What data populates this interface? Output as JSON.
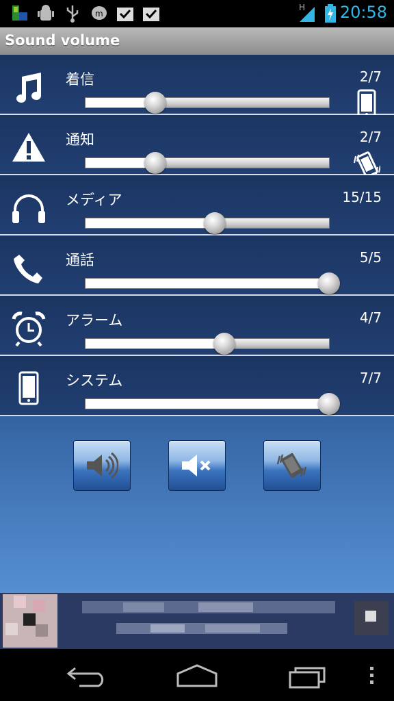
{
  "status_bar": {
    "time": "20:58",
    "network_type": "H",
    "icons": [
      "app-icon",
      "android-debug-icon",
      "usb-icon",
      "messaging-icon",
      "task-done-icon",
      "task-done-icon",
      "signal-icon",
      "battery-charging-icon"
    ]
  },
  "app": {
    "title": "Sound volume"
  },
  "volume_rows": [
    {
      "id": "ringtone",
      "label": "着信",
      "value": "2/7",
      "level": 2,
      "max": 7,
      "icon": "music-note-icon",
      "mode_icon": "phone-icon"
    },
    {
      "id": "notification",
      "label": "通知",
      "value": "2/7",
      "level": 2,
      "max": 7,
      "icon": "warning-icon",
      "mode_icon": "vibrate-icon"
    },
    {
      "id": "media",
      "label": "メディア",
      "value": "15/15",
      "level": 0.53,
      "icon": "headphones-icon"
    },
    {
      "id": "call",
      "label": "通話",
      "value": "5/5",
      "level": 5,
      "max": 5,
      "icon": "phone-handset-icon"
    },
    {
      "id": "alarm",
      "label": "アラーム",
      "value": "4/7",
      "level": 4,
      "max": 7,
      "icon": "alarm-clock-icon"
    },
    {
      "id": "system",
      "label": "システム",
      "value": "7/7",
      "level": 7,
      "max": 7,
      "icon": "smartphone-icon"
    }
  ],
  "mode_buttons": [
    {
      "id": "sound-on",
      "icon": "speaker-icon"
    },
    {
      "id": "mute",
      "icon": "speaker-mute-icon"
    },
    {
      "id": "vibrate",
      "icon": "vibrate-icon"
    }
  ],
  "nav": {
    "icons": [
      "back-icon",
      "home-icon",
      "recent-apps-icon",
      "menu-icon"
    ]
  },
  "colors": {
    "accent": "#33b5e5",
    "row_bg": "#1b3561",
    "button": "#3b74bf"
  }
}
